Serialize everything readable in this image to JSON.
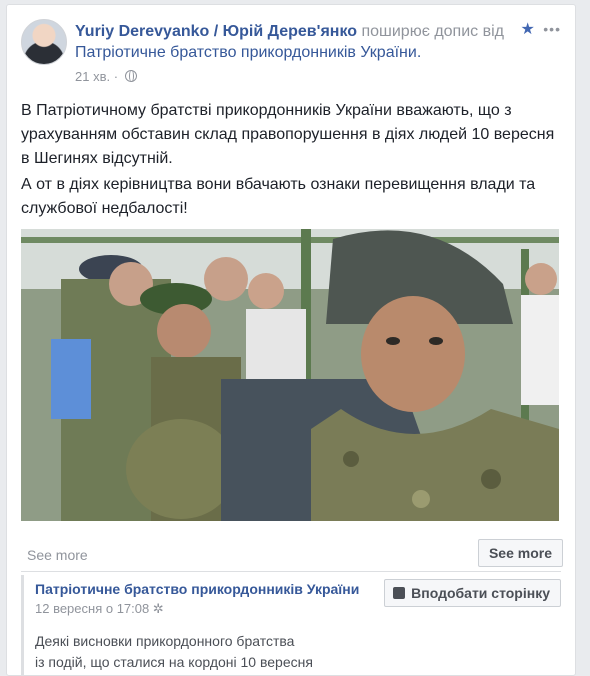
{
  "post": {
    "author": "Yuriy Derevyanko / Юрій Дерев'янко",
    "shares_text": "поширює допис від",
    "shared_page": "Патріотичне братство прикордонників України.",
    "time": "21 хв.",
    "separator": "·",
    "paragraph1": "В Патріотичному братстві прикордонників України вважають, що з урахуванням обставин склад правопорушення в діях людей 10 вересня в Шегинях відсутній.",
    "paragraph2": "А от в діях керівництва вони вбачають ознаки перевищення влади та службової недбалості!",
    "see_more_link": "See more",
    "see_more_button": "See more",
    "icons": {
      "star": "★",
      "dots": "•••"
    }
  },
  "shared": {
    "page_name": "Патріотичне братство прикордонників України",
    "date": "12 вересня о 17:08",
    "gear": "✲",
    "like_button": "Вподобати сторінку",
    "desc_line1": "Деякі висновки прикордонного братства",
    "desc_line2": "із подій, що сталися на кордоні 10 вересня"
  },
  "colors": {
    "link": "#365899",
    "muted": "#90949c",
    "accent": "#4267b2",
    "background": "#e9ebee"
  }
}
